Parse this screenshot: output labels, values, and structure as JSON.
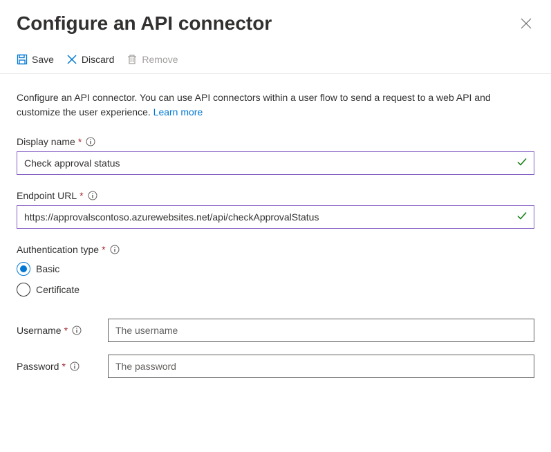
{
  "header": {
    "title": "Configure an API connector"
  },
  "toolbar": {
    "save_label": "Save",
    "discard_label": "Discard",
    "remove_label": "Remove"
  },
  "description": {
    "text": "Configure an API connector. You can use API connectors within a user flow to send a request to a web API and customize the user experience.",
    "learn_more": "Learn more"
  },
  "fields": {
    "display_name": {
      "label": "Display name",
      "value": "Check approval status"
    },
    "endpoint_url": {
      "label": "Endpoint URL",
      "value": "https://approvalscontoso.azurewebsites.net/api/checkApprovalStatus"
    },
    "auth_type": {
      "label": "Authentication type",
      "options": {
        "basic": "Basic",
        "certificate": "Certificate"
      }
    },
    "username": {
      "label": "Username",
      "placeholder": "The username"
    },
    "password": {
      "label": "Password",
      "placeholder": "The password"
    }
  }
}
